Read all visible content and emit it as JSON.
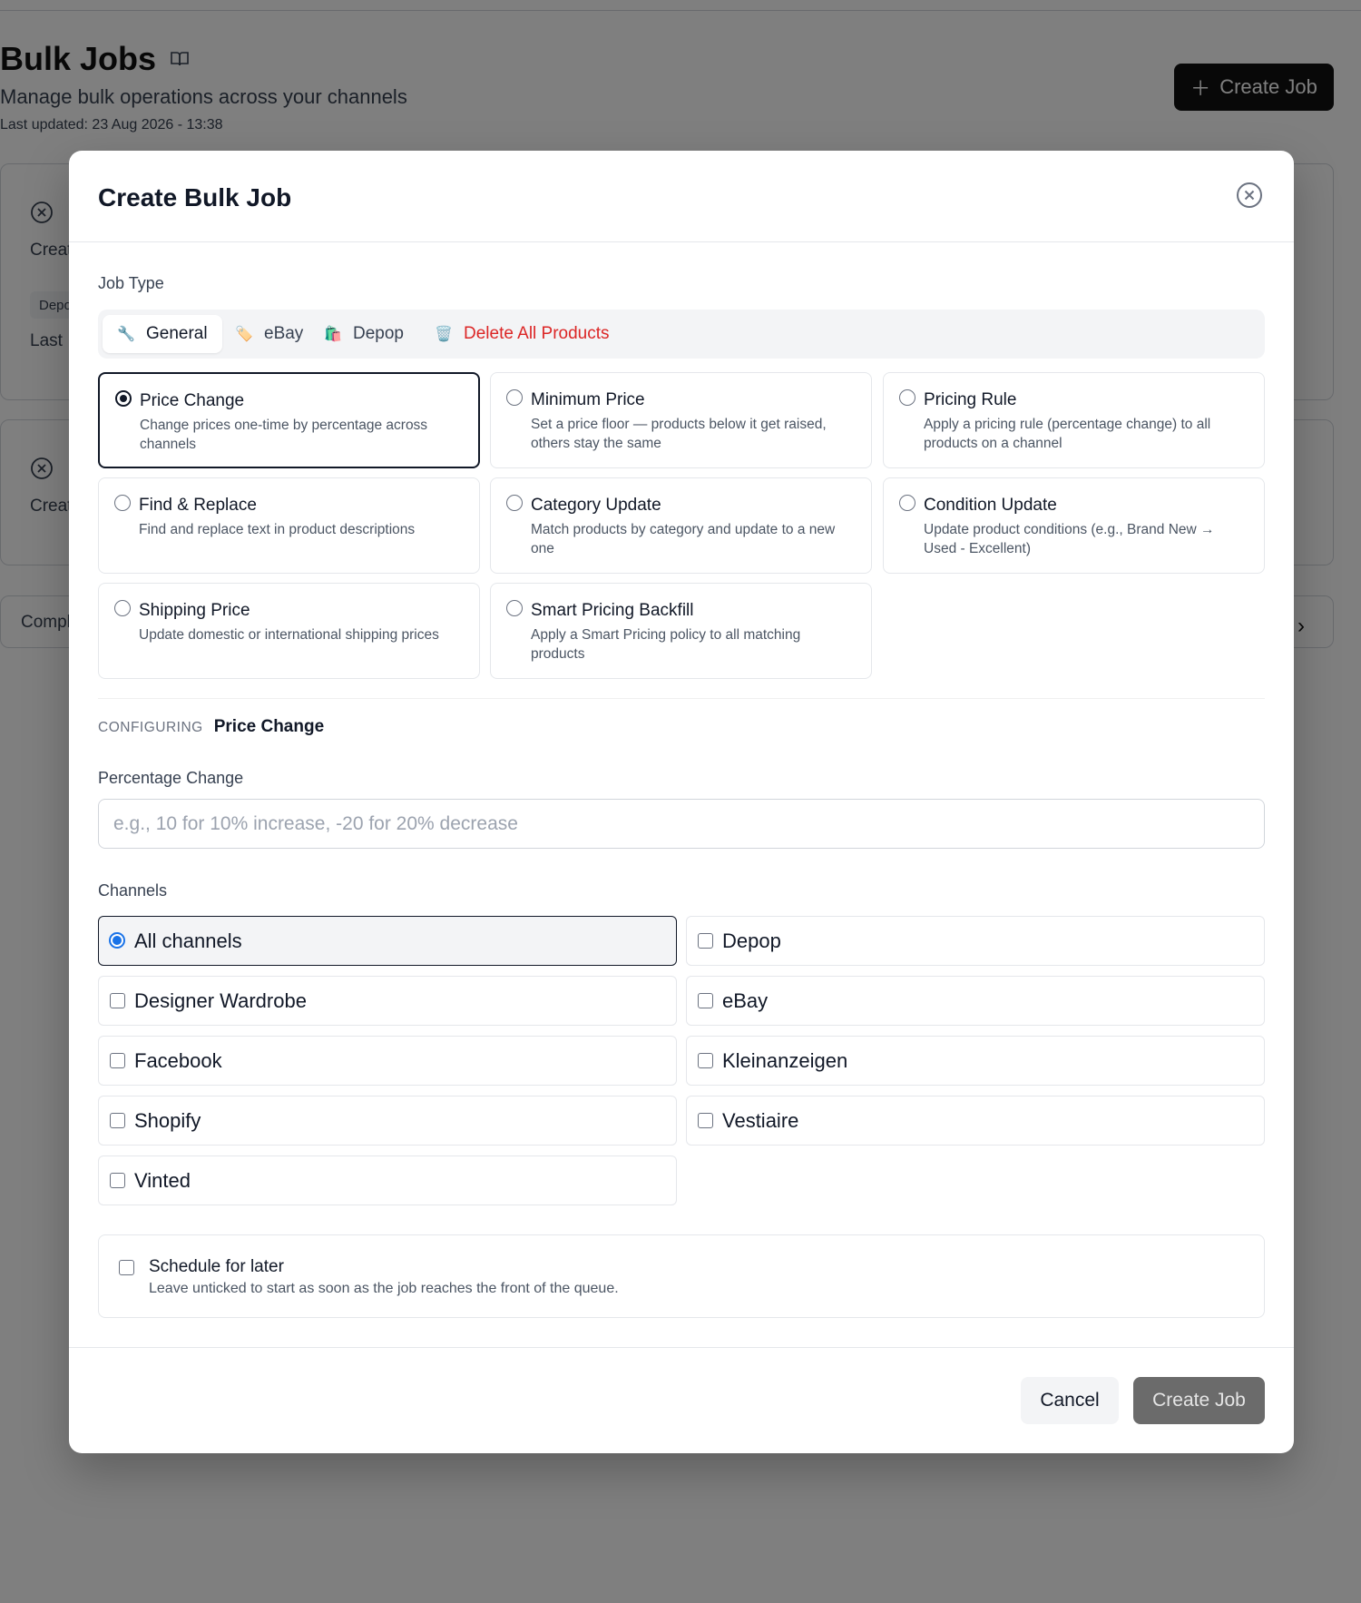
{
  "page": {
    "title": "Bulk Jobs",
    "subtitle": "Manage bulk operations across your channels",
    "last_updated": "Last updated: 23 Aug 2026 - 13:38",
    "create_job_label": "Create Job",
    "bg_cards": {
      "card1_title": "Creat",
      "card1_badge": "Depo",
      "card1_last": "Last",
      "card2_title": "Creat",
      "completed_label": "Compl"
    }
  },
  "modal": {
    "title": "Create Bulk Job",
    "job_type_label": "Job Type",
    "tabs": [
      {
        "label": "General",
        "icon": "wrench-icon",
        "emoji": "🔧",
        "active": true
      },
      {
        "label": "eBay",
        "icon": "tag-icon",
        "emoji": "🏷️",
        "active": false
      },
      {
        "label": "Depop",
        "icon": "shopping-bag-icon",
        "emoji": "🛍️",
        "active": false
      },
      {
        "label": "Delete All Products",
        "icon": "trash-icon",
        "emoji": "🗑️",
        "active": false,
        "danger": true
      }
    ],
    "job_types": [
      {
        "name": "Price Change",
        "desc": "Change prices one-time by percentage across channels",
        "selected": true
      },
      {
        "name": "Minimum Price",
        "desc": "Set a price floor — products below it get raised, others stay the same",
        "selected": false
      },
      {
        "name": "Pricing Rule",
        "desc": "Apply a pricing rule (percentage change) to all products on a channel",
        "selected": false
      },
      {
        "name": "Find & Replace",
        "desc": "Find and replace text in product descriptions",
        "selected": false
      },
      {
        "name": "Category Update",
        "desc": "Match products by category and update to a new one",
        "selected": false
      },
      {
        "name": "Condition Update",
        "desc": "Update product conditions (e.g., Brand New → Used - Excellent)",
        "selected": false
      },
      {
        "name": "Shipping Price",
        "desc": "Update domestic or international shipping prices",
        "selected": false
      },
      {
        "name": "Smart Pricing Backfill",
        "desc": "Apply a Smart Pricing policy to all matching products",
        "selected": false
      }
    ],
    "configuring_label": "CONFIGURING",
    "configuring_value": "Price Change",
    "percentage_label": "Percentage Change",
    "percentage_value": "",
    "percentage_placeholder": "e.g., 10 for 10% increase, -20 for 20% decrease",
    "channels_label": "Channels",
    "channels": [
      {
        "label": "All channels",
        "checked": true
      },
      {
        "label": "Depop",
        "checked": false
      },
      {
        "label": "Designer Wardrobe",
        "checked": false
      },
      {
        "label": "eBay",
        "checked": false
      },
      {
        "label": "Facebook",
        "checked": false
      },
      {
        "label": "Kleinanzeigen",
        "checked": false
      },
      {
        "label": "Shopify",
        "checked": false
      },
      {
        "label": "Vestiaire",
        "checked": false
      },
      {
        "label": "Vinted",
        "checked": false
      }
    ],
    "schedule": {
      "label": "Schedule for later",
      "desc": "Leave unticked to start as soon as the job reaches the front of the queue.",
      "checked": false
    },
    "cancel_label": "Cancel",
    "create_label": "Create Job"
  },
  "colors": {
    "overlay": "rgba(0,0,0,0.5)",
    "danger": "#dc2626",
    "radio_accent": "#1a73e8",
    "primary_dark": "#111111",
    "create_disabled": "#6b6b6b"
  }
}
